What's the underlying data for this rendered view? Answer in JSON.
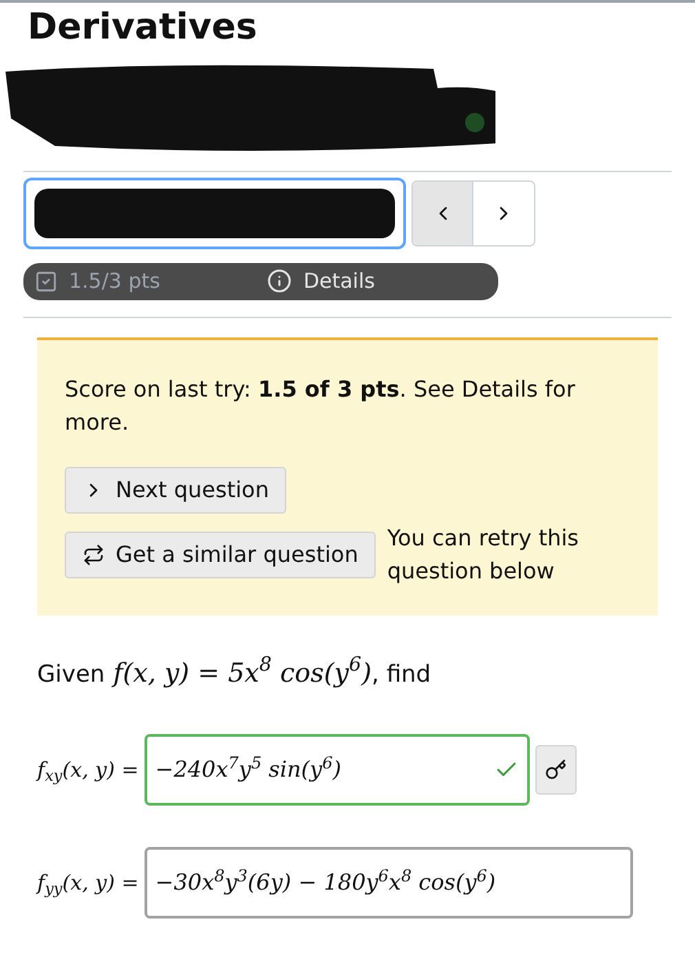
{
  "title": "Derivatives",
  "score_bar": {
    "points": "1.5/3 pts",
    "details": "Details"
  },
  "feedback": {
    "message": "Score on last try: **1.5 of 3 pts**. See Details for more.",
    "buttons": [
      {
        "label": "Next question",
        "kind": "next"
      },
      {
        "label": "Get a similar question",
        "kind": "similar"
      }
    ],
    "retry_note": "You can retry this question below"
  },
  "question": {
    "prompt_start": "Given",
    "formula": "f(x, y) = 5x$^{8}$ cos(y$^{6}$)",
    "prompt_end": ", find",
    "answers": [
      {
        "label": "f$_{xy}$(x, y) =",
        "value": "−240x$^{7}$y$^{5}$ sin(y$^{6}$)",
        "correct": true
      },
      {
        "label": "f$_{yy}$(x, y) =",
        "value": "−30x$^{8}$y$^{3}$(6y) − 180y$^{6}$x$^{8}$ cos(y$^{6}$)",
        "correct": false
      }
    ]
  }
}
